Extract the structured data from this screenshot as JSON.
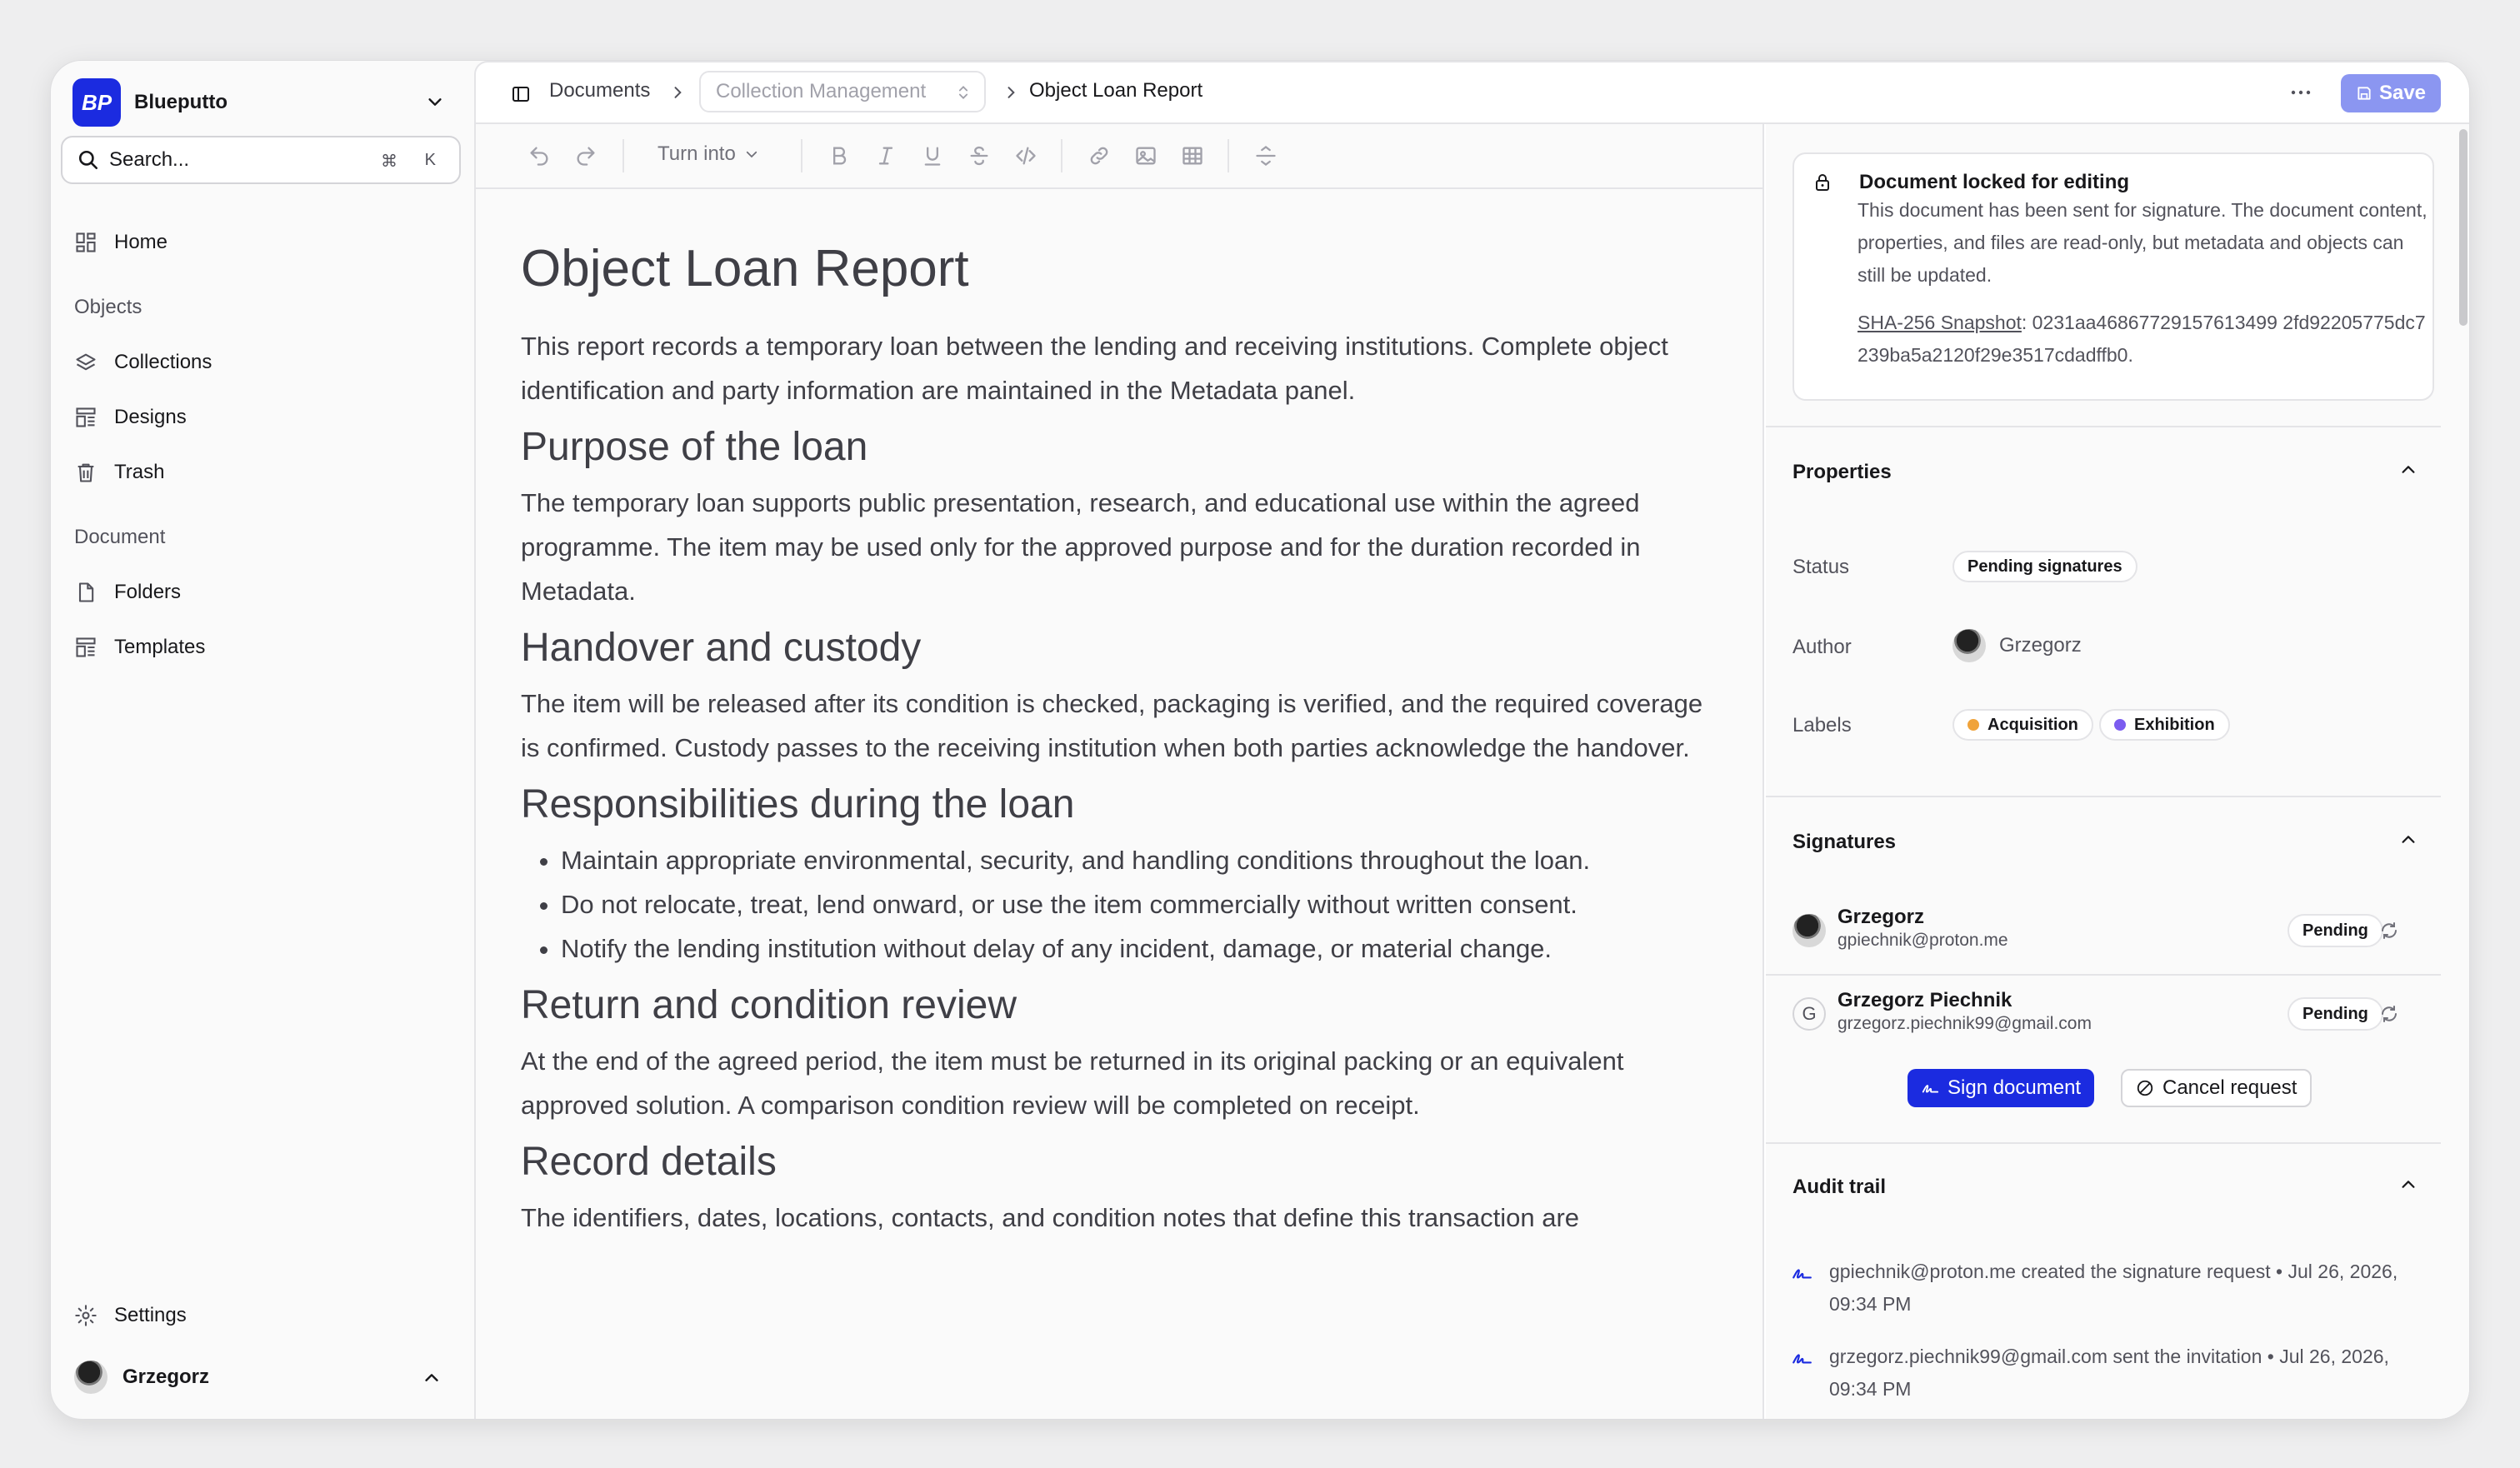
{
  "workspace": {
    "logo_text": "BP",
    "name": "Blueputto"
  },
  "search": {
    "label": "Search...",
    "kbd_cmd": "⌘",
    "kbd_key": "K"
  },
  "sidebar": {
    "home": "Home",
    "objects_heading": "Objects",
    "collections": "Collections",
    "designs": "Designs",
    "trash": "Trash",
    "document_heading": "Document",
    "folders": "Folders",
    "templates": "Templates",
    "settings": "Settings",
    "user": "Grzegorz"
  },
  "topbar": {
    "crumb_documents": "Documents",
    "crumb_collection": "Collection Management",
    "crumb_current": "Object Loan Report",
    "save_label": "Save"
  },
  "toolbar": {
    "turn_into": "Turn into"
  },
  "doc": {
    "title": "Object Loan Report",
    "intro": "This report records a temporary loan between the lending and receiving institutions. Complete object identification and party information are maintained in the Metadata panel.",
    "h_purpose": "Purpose of the loan",
    "p_purpose": "The temporary loan supports public presentation, research, and educational use within the agreed programme. The item may be used only for the approved purpose and for the duration recorded in Metadata.",
    "h_handover": "Handover and custody",
    "p_handover": "The item will be released after its condition is checked, packaging is verified, and the required coverage is confirmed. Custody passes to the receiving institution when both parties acknowledge the handover.",
    "h_resp": "Responsibilities during the loan",
    "resp_items": [
      "Maintain appropriate environmental, security, and handling conditions throughout the loan.",
      "Do not relocate, treat, lend onward, or use the item commercially without written consent.",
      "Notify the lending institution without delay of any incident, damage, or material change."
    ],
    "h_return": "Return and condition review",
    "p_return": "At the end of the agreed period, the item must be returned in its original packing or an equivalent approved solution. A comparison condition review will be completed on receipt.",
    "h_record": "Record details",
    "p_record": "The identifiers, dates, locations, contacts, and condition notes that define this transaction are"
  },
  "lock": {
    "title": "Document locked for editing",
    "body": "This document has been sent for signature. The document content, properties, and files are read-only, but metadata and objects can still be updated.",
    "hash_label": "SHA-256 Snapshot",
    "hash_value": ": 0231aa46867729157613499 2fd92205775dc7239ba5a2120f29e3517cdadffb0."
  },
  "properties": {
    "title": "Properties",
    "status_label": "Status",
    "status_value": "Pending signatures",
    "author_label": "Author",
    "author_value": "Grzegorz",
    "labels_label": "Labels",
    "labels": [
      {
        "name": "Acquisition",
        "color": "#f0a33a"
      },
      {
        "name": "Exhibition",
        "color": "#7b5cf0"
      }
    ]
  },
  "signatures": {
    "title": "Signatures",
    "rows": [
      {
        "name": "Grzegorz",
        "email": "gpiechnik@proton.me",
        "status": "Pending"
      },
      {
        "name": "Grzegorz Piechnik",
        "email": "grzegorz.piechnik99@gmail.com",
        "status": "Pending",
        "initial": "G"
      }
    ],
    "sign_label": "Sign document",
    "cancel_label": "Cancel request"
  },
  "audit": {
    "title": "Audit trail",
    "entries": [
      "gpiechnik@proton.me created the signature request • Jul 26, 2026, 09:34 PM",
      "grzegorz.piechnik99@gmail.com sent the invitation • Jul 26, 2026, 09:34 PM"
    ]
  },
  "colors": {
    "accent": "#1b2be0",
    "save_button": "#8b96f1"
  }
}
